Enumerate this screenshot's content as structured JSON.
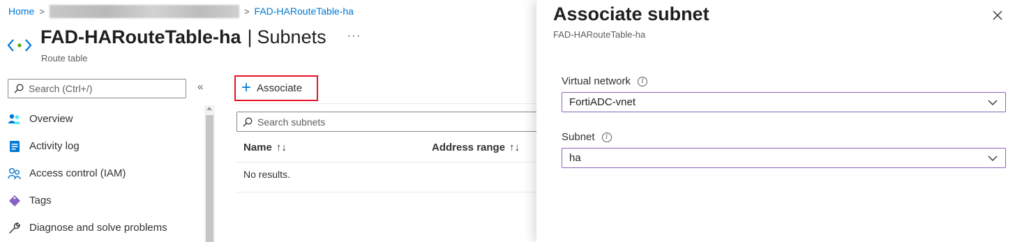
{
  "breadcrumb": {
    "home": "Home",
    "current": "FAD-HARouteTable-ha"
  },
  "header": {
    "title": "FAD-HARouteTable-ha",
    "separator": "|",
    "section": "Subnets",
    "more": "···",
    "resource_type": "Route table"
  },
  "sidebar": {
    "search_placeholder": "Search (Ctrl+/)",
    "collapse": "«",
    "items": [
      {
        "label": "Overview",
        "icon": "overview-icon"
      },
      {
        "label": "Activity log",
        "icon": "activity-log-icon"
      },
      {
        "label": "Access control (IAM)",
        "icon": "access-control-icon"
      },
      {
        "label": "Tags",
        "icon": "tag-icon"
      },
      {
        "label": "Diagnose and solve problems",
        "icon": "wrench-icon"
      }
    ]
  },
  "toolbar": {
    "associate_label": "Associate"
  },
  "grid": {
    "search_placeholder": "Search subnets",
    "columns": [
      "Name",
      "Address range"
    ],
    "sort_glyph": "↑↓",
    "empty_text": "No results."
  },
  "blade": {
    "title": "Associate subnet",
    "subtitle": "FAD-HARouteTable-ha",
    "fields": [
      {
        "label": "Virtual network",
        "value": "FortiADC-vnet"
      },
      {
        "label": "Subnet",
        "value": "ha"
      }
    ],
    "info_glyph": "i"
  },
  "colors": {
    "link": "#0078d4",
    "highlight_border": "#e81123",
    "focus_border": "#8764b8"
  }
}
